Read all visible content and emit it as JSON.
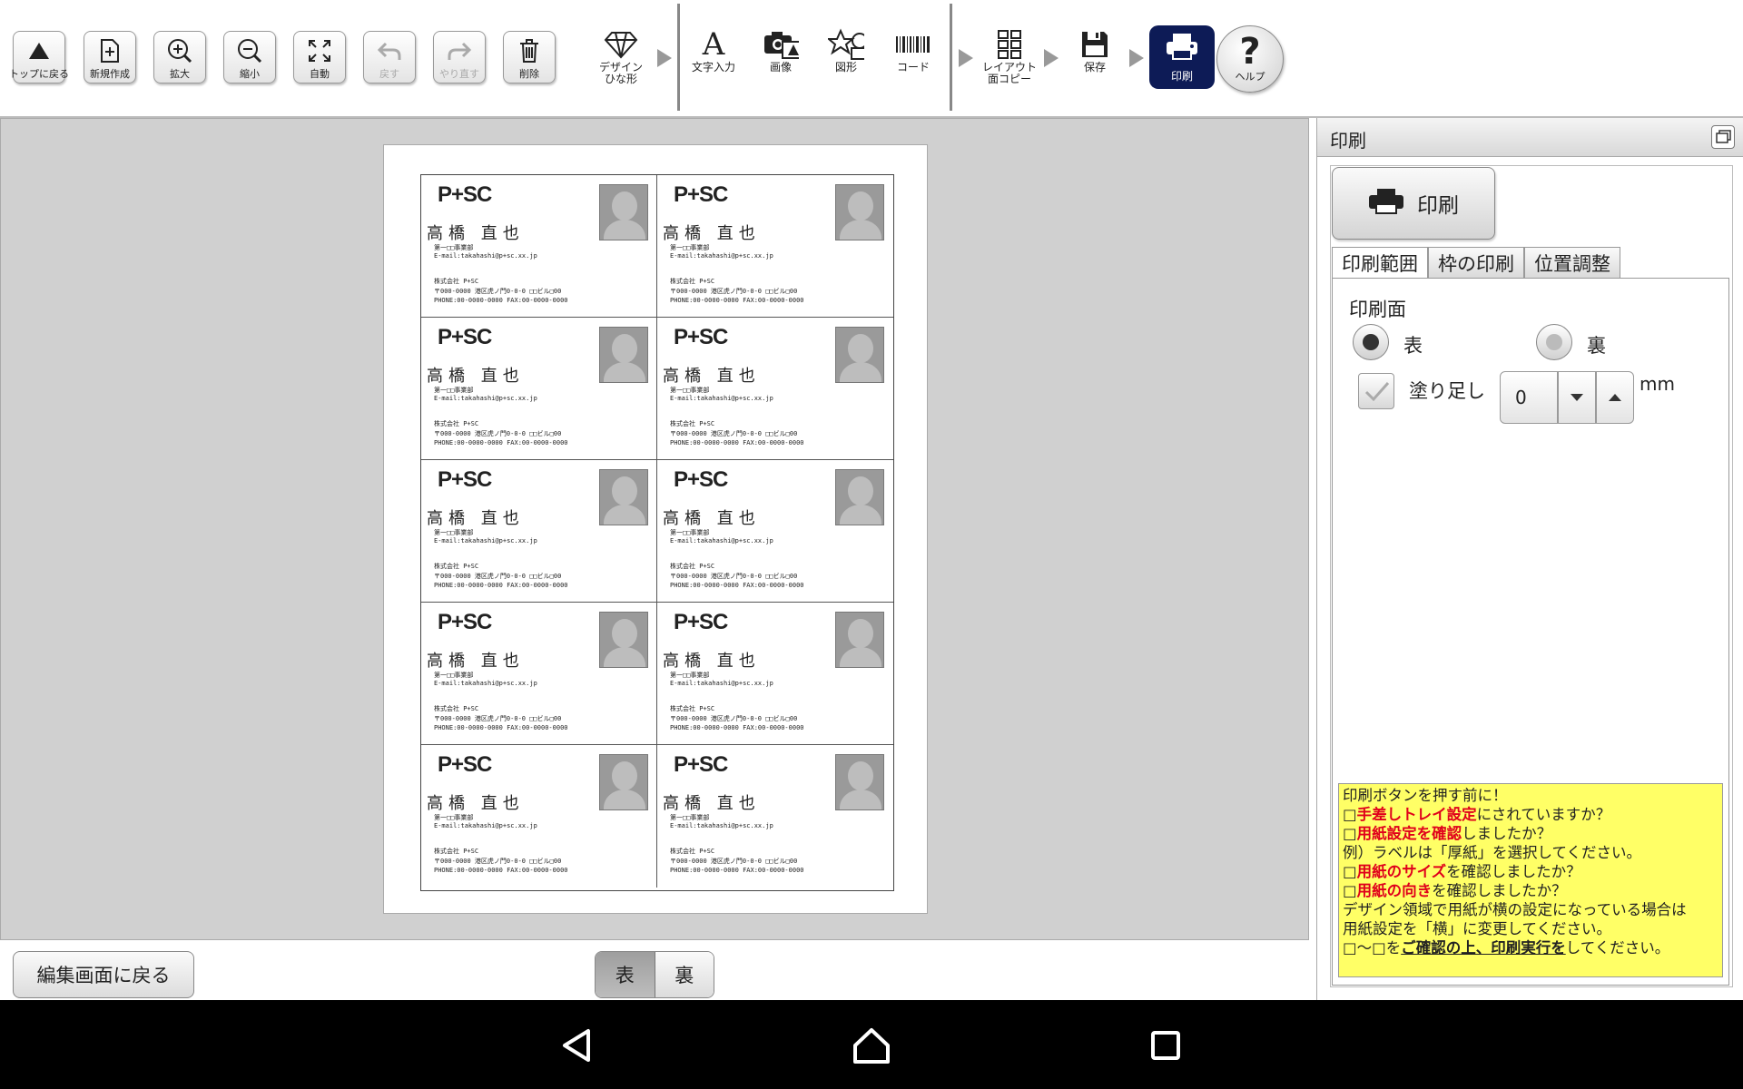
{
  "toolbar": {
    "buttons": [
      {
        "label": "トップに戻る",
        "icon": "triangle-up-icon"
      },
      {
        "label": "新規作成",
        "icon": "new-file-icon"
      },
      {
        "label": "拡大",
        "icon": "zoom-in-icon"
      },
      {
        "label": "縮小",
        "icon": "zoom-out-icon"
      },
      {
        "label": "自動",
        "icon": "fit-icon"
      },
      {
        "label": "戻す",
        "icon": "undo-icon"
      },
      {
        "label": "やり直す",
        "icon": "redo-icon"
      },
      {
        "label": "削除",
        "icon": "trash-icon"
      }
    ],
    "tools": {
      "design": "デザイン\nひな形",
      "text": "文字入力",
      "image": "画像",
      "shape": "図形",
      "code": "コード",
      "layout": "レイアウト\n面コピー",
      "save": "保存",
      "print": "印刷",
      "help": "ヘルプ"
    }
  },
  "card": {
    "logo": "P+SC",
    "name": "高橋 直也",
    "dept": "第一□□事業部",
    "email": "E-mail:takahashi@p+sc.xx.jp",
    "company": "株式会社 P+SC",
    "address": "〒000-0000 港区虎ノ門0-0-0 □□ビル□00",
    "phone": "PHONE:00-0000-0000 FAX:00-0000-0000"
  },
  "bottom": {
    "back_label": "編集画面に戻る",
    "front_label": "表",
    "back_side_label": "裏"
  },
  "panel": {
    "title": "印刷",
    "print_button": "印刷",
    "tabs": [
      "印刷範囲",
      "枠の印刷",
      "位置調整"
    ],
    "active_tab": 0,
    "print_face_label": "印刷面",
    "face_front": "表",
    "face_back": "裏",
    "selected_face": "表",
    "bleed_label": "塗り足し",
    "bleed_value": "0",
    "bleed_unit": "mm",
    "note": {
      "heading": "印刷ボタンを押す前に！",
      "l1_red": "手差しトレイ設定",
      "l1_rest": "にされていますか？",
      "l2_red": "用紙設定を確認",
      "l2_rest": "しましたか？",
      "l3": "例）ラベルは「厚紙」を選択してください。",
      "l4_red": "用紙のサイズ",
      "l4_rest": "を確認しましたか？",
      "l5_red": "用紙の向き",
      "l5_rest": "を確認しましたか？",
      "l6": "デザイン領域で用紙が横の設定になっている場合は",
      "l7": "用紙設定を「横」に変更してください。",
      "l8_pre": "〜",
      "l8_mid": "を",
      "l8_ul": "ご確認の上、印刷実行を",
      "l8_rest": "してください。"
    }
  },
  "colors": {
    "accent": "#0d1b56",
    "note_bg": "#ffff66",
    "note_red": "#e0001b",
    "canvas_bg": "#d0d0d0"
  }
}
